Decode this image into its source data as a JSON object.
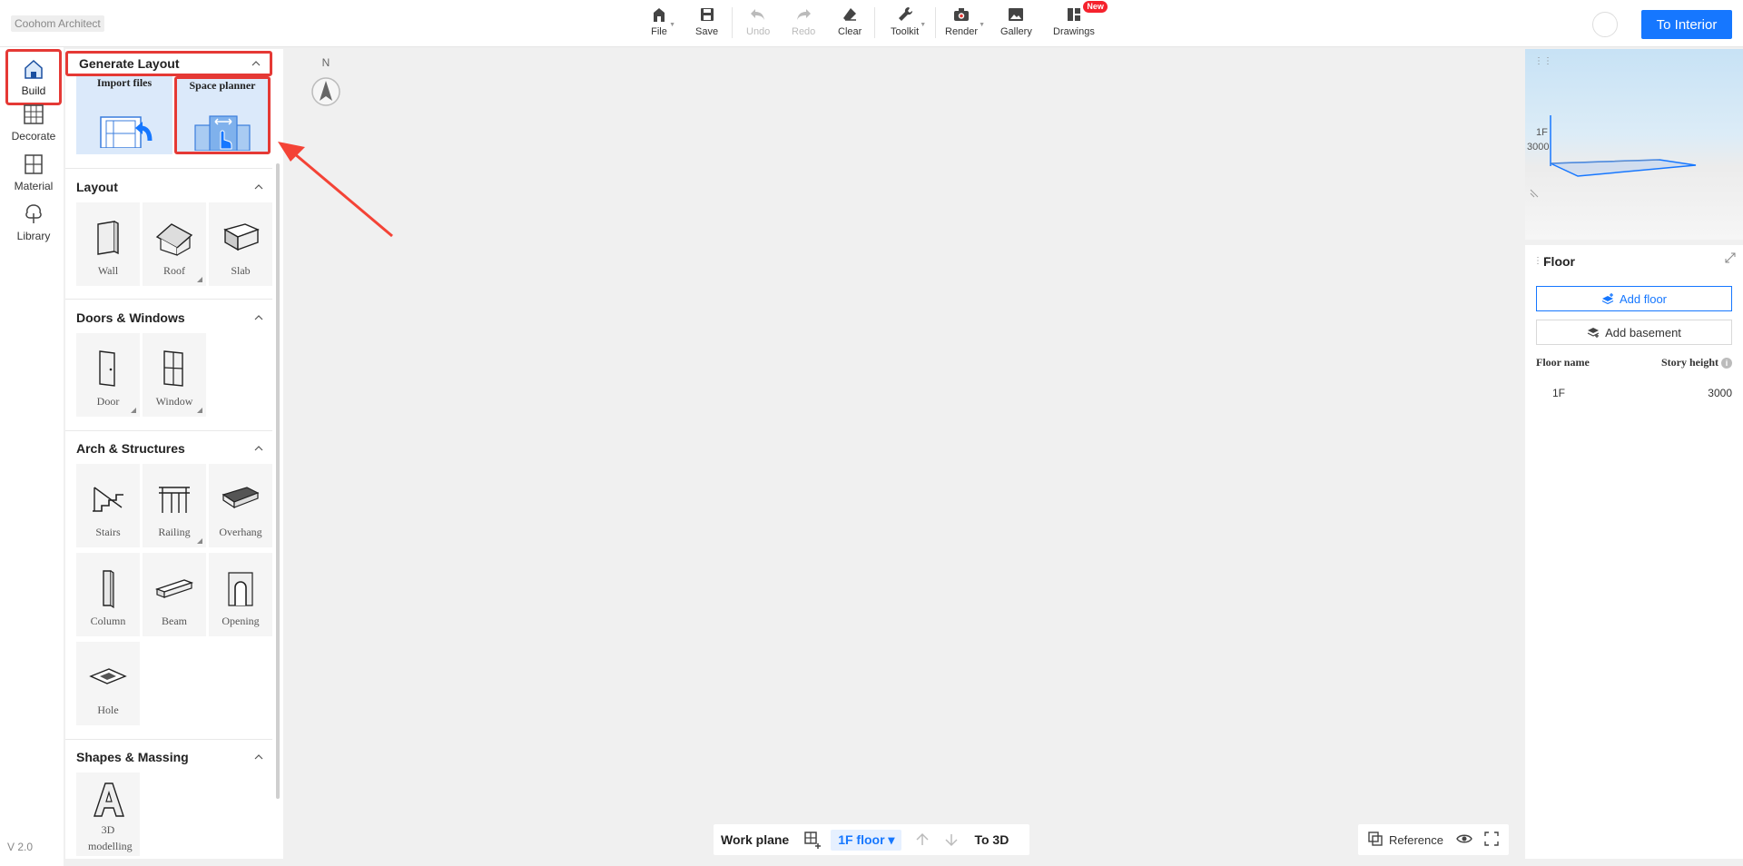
{
  "app": {
    "title": "Coohom Architect",
    "version": "V 2.0"
  },
  "toolbar": {
    "file": "File",
    "save": "Save",
    "undo": "Undo",
    "redo": "Redo",
    "clear": "Clear",
    "toolkit": "Toolkit",
    "render": "Render",
    "gallery": "Gallery",
    "drawings": "Drawings",
    "new_badge": "New",
    "to_interior": "To Interior"
  },
  "leftnav": {
    "build": "Build",
    "decorate": "Decorate",
    "material": "Material",
    "library": "Library"
  },
  "catalog": {
    "generate_layout": {
      "title": "Generate Layout",
      "import_files": "Import files",
      "space_planner": "Space planner"
    },
    "layout": {
      "title": "Layout",
      "items": [
        "Wall",
        "Roof",
        "Slab"
      ]
    },
    "doors_windows": {
      "title": "Doors & Windows",
      "items": [
        "Door",
        "Window"
      ]
    },
    "arch_structures": {
      "title": "Arch & Structures",
      "items": [
        "Stairs",
        "Railing",
        "Overhang",
        "Column",
        "Beam",
        "Opening",
        "Hole"
      ]
    },
    "shapes_massing": {
      "title": "Shapes & Massing",
      "items": [
        "3D modelling"
      ]
    }
  },
  "canvas": {
    "compass_label": "N"
  },
  "bottombar": {
    "work_plane": "Work plane",
    "floor": "1F floor",
    "to_3d": "To 3D"
  },
  "reference": {
    "label": "Reference"
  },
  "preview": {
    "floor_label": "1F",
    "height_label": "3000"
  },
  "floor_panel": {
    "title": "Floor",
    "add_floor": "Add floor",
    "add_basement": "Add basement",
    "col_name": "Floor name",
    "col_height": "Story height",
    "rows": [
      {
        "name": "1F",
        "height": "3000"
      }
    ]
  },
  "colors": {
    "accent": "#1677ff",
    "highlight": "#e53935"
  }
}
